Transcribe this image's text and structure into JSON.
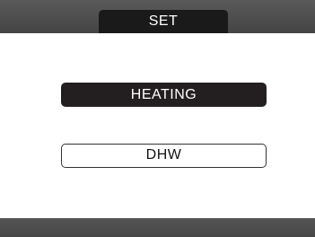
{
  "header": {
    "title": "SET"
  },
  "menu": {
    "items": [
      {
        "label": "HEATING",
        "selected": true
      },
      {
        "label": "DHW",
        "selected": false
      }
    ]
  },
  "colors": {
    "bar": "#4a4a4a",
    "selected_bg": "#231f20",
    "selected_text": "#ffffff",
    "background": "#ffffff"
  }
}
